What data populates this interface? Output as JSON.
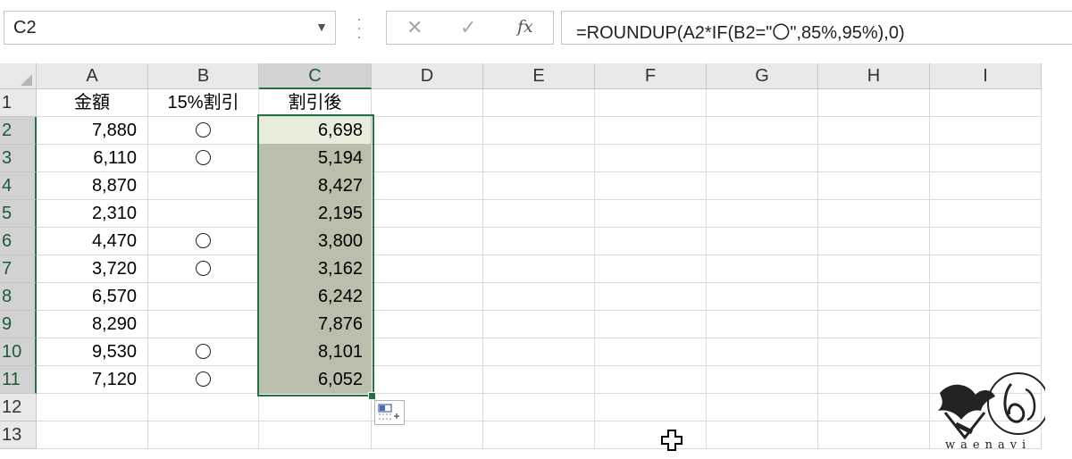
{
  "formula_bar": {
    "name_box": "C2",
    "cancel_icon": "✕",
    "enter_icon": "✓",
    "fx_label": "fx",
    "formula": "=ROUNDUP(A2*IF(B2=\"〇\",85%,95%),0)"
  },
  "columns": [
    "A",
    "B",
    "C",
    "D",
    "E",
    "F",
    "G",
    "H",
    "I"
  ],
  "selected_column": "C",
  "rows": [
    "1",
    "2",
    "3",
    "4",
    "5",
    "6",
    "7",
    "8",
    "9",
    "10",
    "11",
    "12",
    "13"
  ],
  "selected_rows": [
    "2",
    "3",
    "4",
    "5",
    "6",
    "7",
    "8",
    "9",
    "10",
    "11"
  ],
  "headers": {
    "a": "金額",
    "b": "15%割引",
    "c": "割引後"
  },
  "table": [
    {
      "amount": "7,880",
      "discount": "○",
      "after": "6,698"
    },
    {
      "amount": "6,110",
      "discount": "○",
      "after": "5,194"
    },
    {
      "amount": "8,870",
      "discount": "",
      "after": "8,427"
    },
    {
      "amount": "2,310",
      "discount": "",
      "after": "2,195"
    },
    {
      "amount": "4,470",
      "discount": "○",
      "after": "3,800"
    },
    {
      "amount": "3,720",
      "discount": "○",
      "after": "3,162"
    },
    {
      "amount": "6,570",
      "discount": "",
      "after": "6,242"
    },
    {
      "amount": "8,290",
      "discount": "",
      "after": "7,876"
    },
    {
      "amount": "9,530",
      "discount": "○",
      "after": "8,101"
    },
    {
      "amount": "7,120",
      "discount": "○",
      "after": "6,052"
    }
  ],
  "watermark": {
    "text": "waenavi"
  },
  "colors": {
    "accent": "#217346",
    "selection": "#b9bfaa",
    "header_bg": "#e9e9e9"
  }
}
